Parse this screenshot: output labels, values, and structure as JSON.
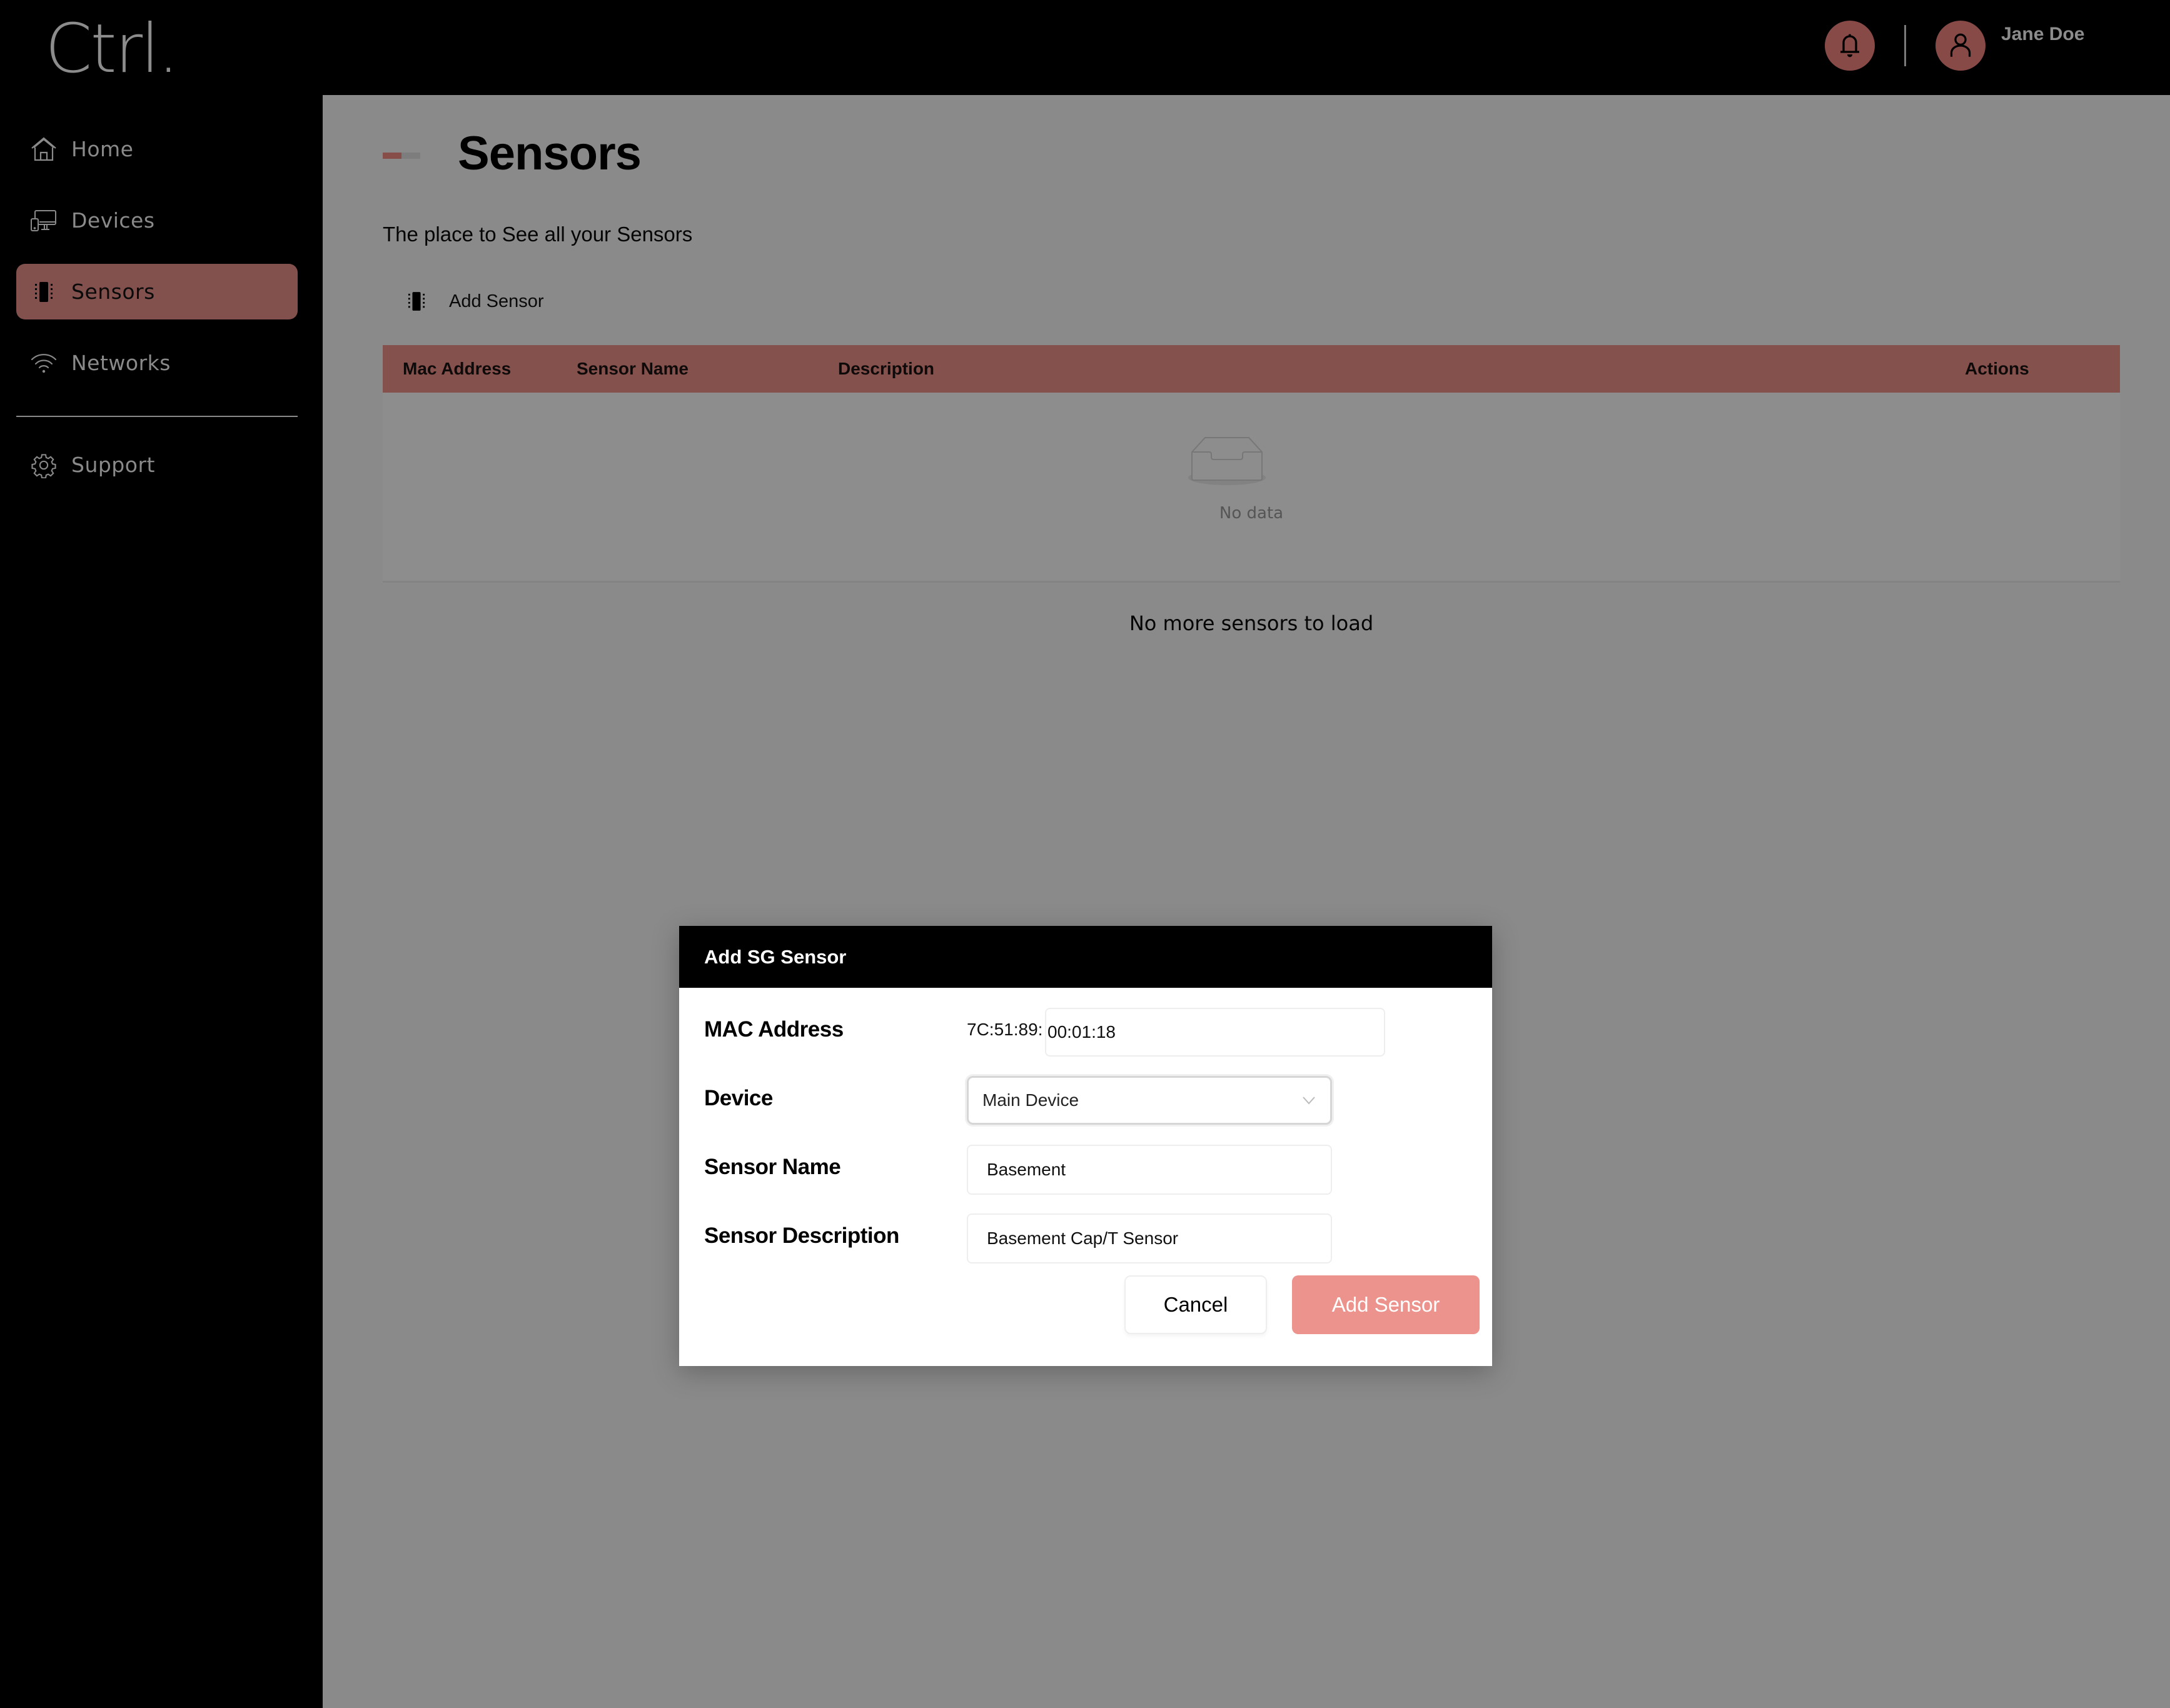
{
  "app": {
    "logo": "Ctrl.",
    "user_name": "Jane Doe",
    "accent_color": "#874a47",
    "primary_button_color": "#ed938d"
  },
  "header": {
    "notifications_icon": "bell-icon",
    "avatar_icon": "user-icon"
  },
  "sidebar": {
    "items": [
      {
        "label": "Home",
        "icon": "home-icon",
        "active": false
      },
      {
        "label": "Devices",
        "icon": "devices-icon",
        "active": false
      },
      {
        "label": "Sensors",
        "icon": "sensor-chip-icon",
        "active": true
      },
      {
        "label": "Networks",
        "icon": "wifi-icon",
        "active": false
      },
      {
        "label": "Support",
        "icon": "gear-icon",
        "active": false
      }
    ]
  },
  "page": {
    "title": "Sensors",
    "subtitle": "The place to See all your Sensors",
    "add_sensor_label": "Add Sensor",
    "table": {
      "columns": [
        "Mac Address",
        "Sensor Name",
        "Description",
        "Actions"
      ],
      "rows": [],
      "empty_text": "No data"
    },
    "footer_text": "No more sensors to load"
  },
  "modal": {
    "title": "Add SG Sensor",
    "fields": {
      "mac": {
        "label": "MAC Address",
        "prefix": "7C:51:89:",
        "value": "00:01:18"
      },
      "device": {
        "label": "Device",
        "value": "Main Device"
      },
      "name": {
        "label": "Sensor Name",
        "value": "Basement"
      },
      "description": {
        "label": "Sensor Description",
        "value": "Basement Cap/T Sensor"
      }
    },
    "cancel_label": "Cancel",
    "submit_label": "Add Sensor"
  }
}
